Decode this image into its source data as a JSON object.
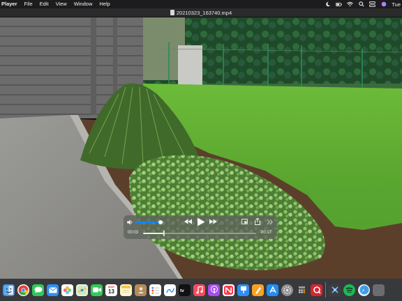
{
  "menubar": {
    "app_name": "Player",
    "items": [
      "File",
      "Edit",
      "View",
      "Window",
      "Help"
    ],
    "clock": "Tue"
  },
  "titlebar": {
    "filename": "20210323_163740.mp4"
  },
  "player": {
    "current_time": "00:03",
    "duration": "00:17",
    "playback_progress": 0.18,
    "volume_level": 0.9
  },
  "dock": {
    "calendar_day": "13",
    "calendar_month": "MAR",
    "apps": [
      "finder-icon",
      "chrome-icon",
      "messages-icon",
      "mail-icon",
      "photos-icon",
      "maps-icon",
      "facetime-icon",
      "calendar-icon",
      "notes-icon",
      "contacts-icon",
      "reminders-icon",
      "freeform-icon",
      "appletv-icon",
      "music-icon",
      "podcasts-icon",
      "news-icon",
      "keynote-icon",
      "pages-icon",
      "appstore-icon",
      "settings-icon",
      "calculator-icon",
      "quicktime-icon",
      "tool-icon",
      "spotify-icon",
      "safari-icon",
      "other-icon"
    ]
  },
  "colors": {
    "menubar_bg": "#1c1c1e",
    "dock_bg": "#3c3e42",
    "controls_bg": "#5f645c",
    "accent": "#0a84ff"
  }
}
